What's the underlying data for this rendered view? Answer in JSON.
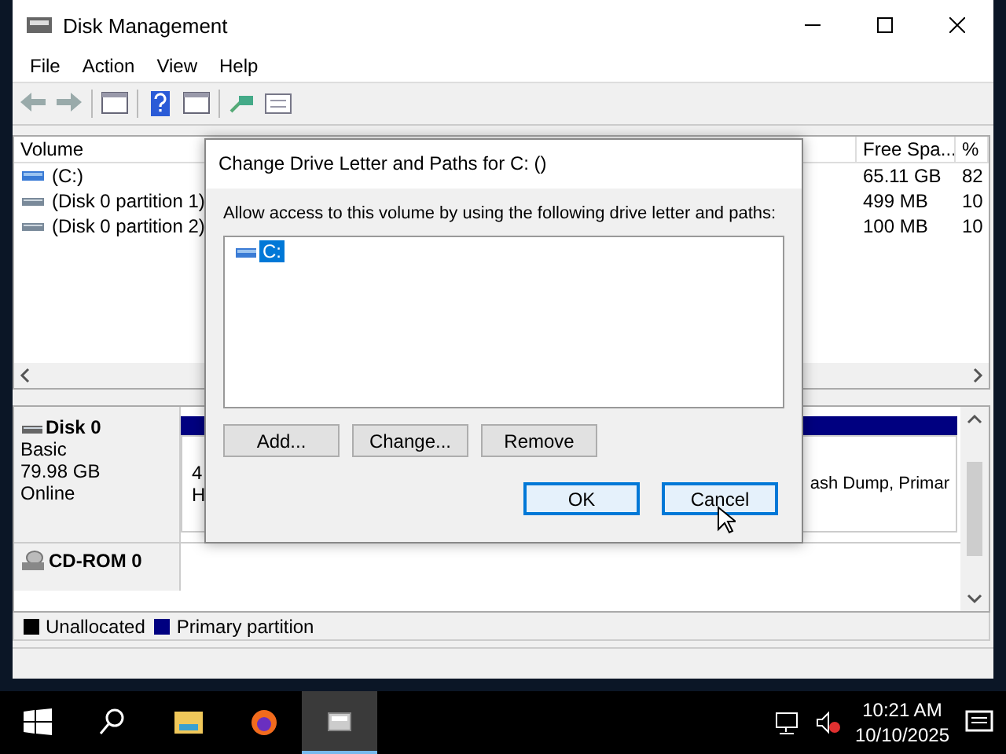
{
  "window": {
    "title": "Disk Management"
  },
  "menu": [
    {
      "label": "File"
    },
    {
      "label": "Action"
    },
    {
      "label": "View"
    },
    {
      "label": "Help"
    }
  ],
  "volume_list": {
    "columns": [
      "Volume",
      "Free Spa...",
      "%"
    ],
    "rows": [
      {
        "volume": "(C:)",
        "kind": "system",
        "free": "65.11 GB",
        "percent": "82"
      },
      {
        "volume": "(Disk 0 partition 1)",
        "kind": "plain",
        "free": "499 MB",
        "percent": "10"
      },
      {
        "volume": "(Disk 0 partition 2)",
        "kind": "plain",
        "free": "100 MB",
        "percent": "10"
      }
    ]
  },
  "disks": [
    {
      "name": "Disk 0",
      "kind": "disk",
      "lines": [
        "Basic",
        "79.98 GB",
        "Online"
      ],
      "partition_1": [
        "4",
        "H"
      ],
      "partition_3": "ash Dump, Primar"
    },
    {
      "name": "CD-ROM 0",
      "kind": "cdrom"
    }
  ],
  "legend": [
    {
      "label": "Unallocated",
      "color": "#000000"
    },
    {
      "label": "Primary partition",
      "color": "#000080"
    }
  ],
  "dialog": {
    "title": "Change Drive Letter and Paths for C: ()",
    "prompt": "Allow access to this volume by using the following drive letter and paths:",
    "paths": [
      {
        "label": "C:",
        "selected": true
      }
    ],
    "actions": [
      {
        "label": "Add...",
        "highlighted": false
      },
      {
        "label": "Change...",
        "highlighted": false
      },
      {
        "label": "Remove",
        "highlighted": false
      }
    ],
    "buttons": [
      {
        "label": "OK",
        "highlighted": true
      },
      {
        "label": "Cancel",
        "highlighted": true
      }
    ]
  },
  "taskbar": {
    "items": [
      {
        "kind": "start",
        "selected": false
      },
      {
        "kind": "search",
        "selected": false
      },
      {
        "kind": "folder",
        "selected": false
      },
      {
        "kind": "browser",
        "selected": false
      },
      {
        "kind": "disk",
        "selected": true
      }
    ],
    "time": "10:21 AM",
    "date": "10/10/2025"
  }
}
